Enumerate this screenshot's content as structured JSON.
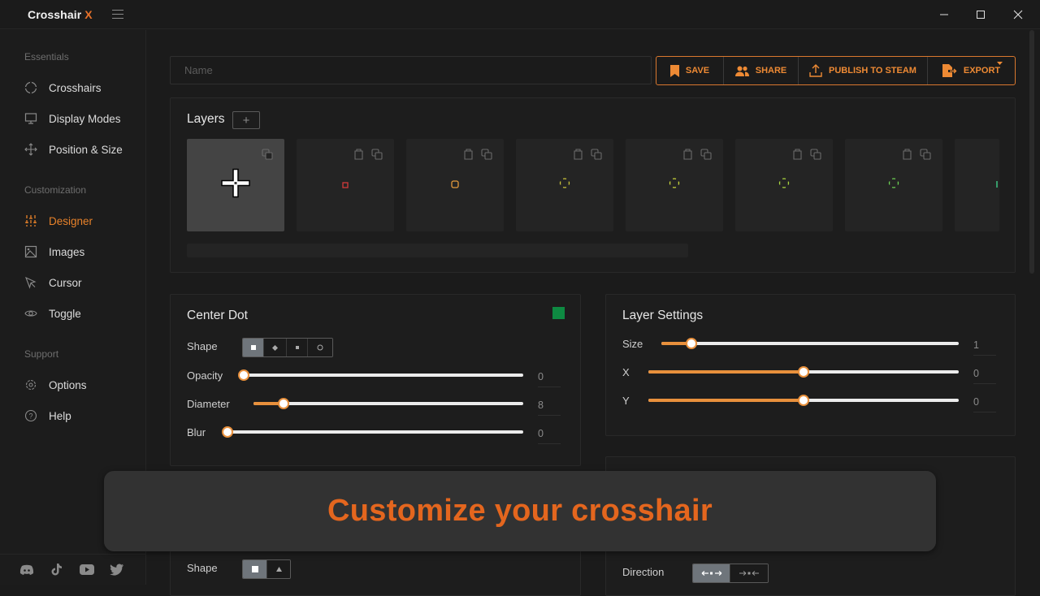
{
  "window": {
    "title_main": "Crosshair",
    "title_accent": "X",
    "controls": [
      "minimize",
      "maximize",
      "close"
    ]
  },
  "sidebar": {
    "sections": [
      {
        "label": "Essentials",
        "items": [
          {
            "label": "Crosshairs",
            "icon": "crosshair-circle-icon",
            "active": false
          },
          {
            "label": "Display Modes",
            "icon": "monitor-icon",
            "active": false
          },
          {
            "label": "Position & Size",
            "icon": "move-arrows-icon",
            "active": false
          }
        ]
      },
      {
        "label": "Customization",
        "items": [
          {
            "label": "Designer",
            "icon": "sliders-icon",
            "active": true
          },
          {
            "label": "Images",
            "icon": "image-icon",
            "active": false
          },
          {
            "label": "Cursor",
            "icon": "cursor-icon",
            "active": false
          },
          {
            "label": "Toggle",
            "icon": "eye-icon",
            "active": false
          }
        ]
      },
      {
        "label": "Support",
        "items": [
          {
            "label": "Options",
            "icon": "gear-icon",
            "active": false
          },
          {
            "label": "Help",
            "icon": "help-circle-icon",
            "active": false
          }
        ]
      }
    ],
    "social": [
      "discord-icon",
      "tiktok-icon",
      "youtube-icon",
      "twitter-icon"
    ]
  },
  "toolbar": {
    "name_value": "",
    "name_placeholder": "Name",
    "save_label": "SAVE",
    "share_label": "SHARE",
    "publish_label": "PUBLISH TO STEAM",
    "export_label": "EXPORT",
    "accent_color": "#ee8a34"
  },
  "layers": {
    "title": "Layers",
    "add_label": "+",
    "items": [
      {
        "type": "cross",
        "color": "#ffffff",
        "selected": true,
        "deletable": false
      },
      {
        "type": "square",
        "color": "#d23a3a",
        "selected": false,
        "deletable": true
      },
      {
        "type": "rounded-square",
        "color": "#e39a3c",
        "selected": false,
        "deletable": true
      },
      {
        "type": "circle-gap",
        "color": "#c9c23a",
        "selected": false,
        "deletable": true
      },
      {
        "type": "circle-gap",
        "color": "#c8d43a",
        "selected": false,
        "deletable": true
      },
      {
        "type": "circle-gap",
        "color": "#a9d43e",
        "selected": false,
        "deletable": true
      },
      {
        "type": "circle-gap",
        "color": "#6ccf52",
        "selected": false,
        "deletable": true
      },
      {
        "type": "partial",
        "color": "#3ecf8a",
        "selected": false,
        "deletable": true
      }
    ]
  },
  "center_dot": {
    "title": "Center Dot",
    "color": "#0e8a42",
    "shape_label": "Shape",
    "shape_options": [
      "square",
      "diamond",
      "small-square",
      "circle"
    ],
    "shape_selected": 0,
    "opacity": {
      "label": "Opacity",
      "value": "0",
      "fraction": 0.0
    },
    "diameter": {
      "label": "Diameter",
      "value": "8",
      "fraction": 0.11
    },
    "blur": {
      "label": "Blur",
      "value": "0",
      "fraction": 0.0
    }
  },
  "layer_settings": {
    "title": "Layer Settings",
    "size": {
      "label": "Size",
      "value": "1",
      "fraction": 0.1
    },
    "x": {
      "label": "X",
      "value": "0",
      "fraction": 0.5
    },
    "y": {
      "label": "Y",
      "value": "0",
      "fraction": 0.5
    }
  },
  "lower_left": {
    "shape_label": "Shape",
    "shape_options": [
      "square",
      "triangle"
    ],
    "shape_selected": 0
  },
  "lower_right": {
    "direction_label": "Direction",
    "direction_options": [
      "outward",
      "inward"
    ],
    "direction_selected": 0
  },
  "overlay": {
    "caption": "Customize your crosshair"
  }
}
